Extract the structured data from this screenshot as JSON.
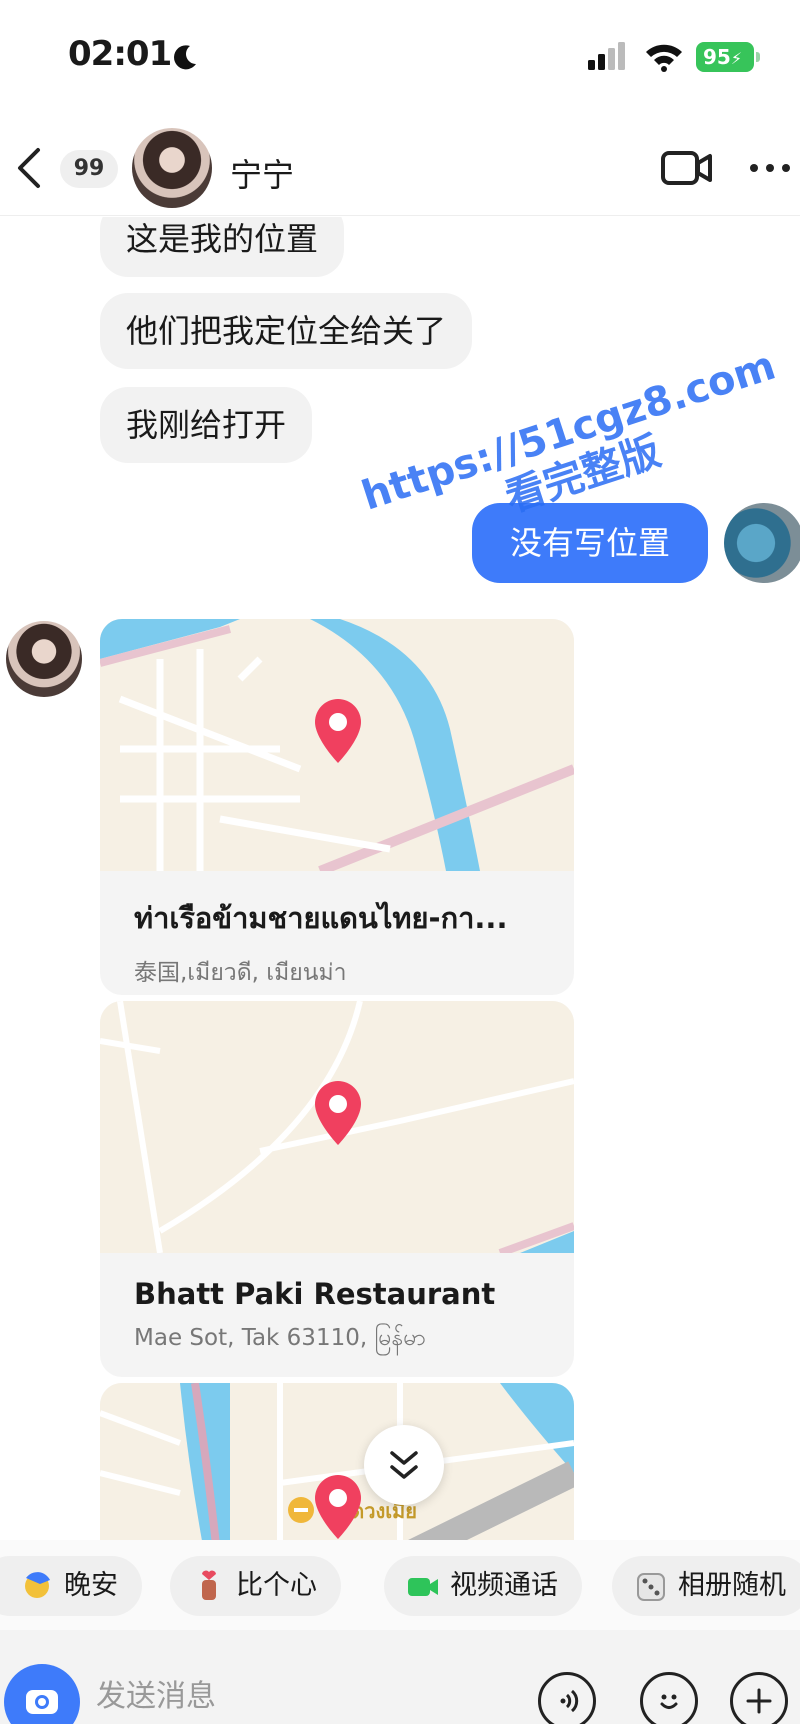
{
  "status_bar": {
    "time": "02:01",
    "battery": "95"
  },
  "header": {
    "unread_count": "99",
    "contact_name": "宁宁"
  },
  "messages": {
    "in_1": "这是我的位置",
    "in_2": "他们把我定位全给关了",
    "in_3": "我刚给打开",
    "out_1": "没有写位置"
  },
  "locations": [
    {
      "name": "ท่าเรือข้ามชายแดนไทย-กา...",
      "address": "泰国,เมียวดี, เมียนม่า"
    },
    {
      "name": "Bhatt Paki Restaurant",
      "address": "Mae Sot, Tak 63110, မြန်မာ"
    },
    {
      "name": "",
      "address": "",
      "map_label": "าดวงเมีย"
    }
  ],
  "watermark": {
    "line1": "https://51cgz8.com",
    "line2": "看完整版"
  },
  "quick_replies": [
    {
      "label": "晚安",
      "icon": "moon-face-icon"
    },
    {
      "label": "比个心",
      "icon": "heart-gesture-icon"
    },
    {
      "label": "视频通话",
      "icon": "video-camera-icon"
    },
    {
      "label": "相册随机",
      "icon": "dice-icon"
    }
  ],
  "input": {
    "placeholder": "发送消息"
  },
  "colors": {
    "accent": "#3e7bfa",
    "pin": "#f0405f",
    "river": "#7ccbee",
    "map_bg": "#f6f0e4"
  }
}
